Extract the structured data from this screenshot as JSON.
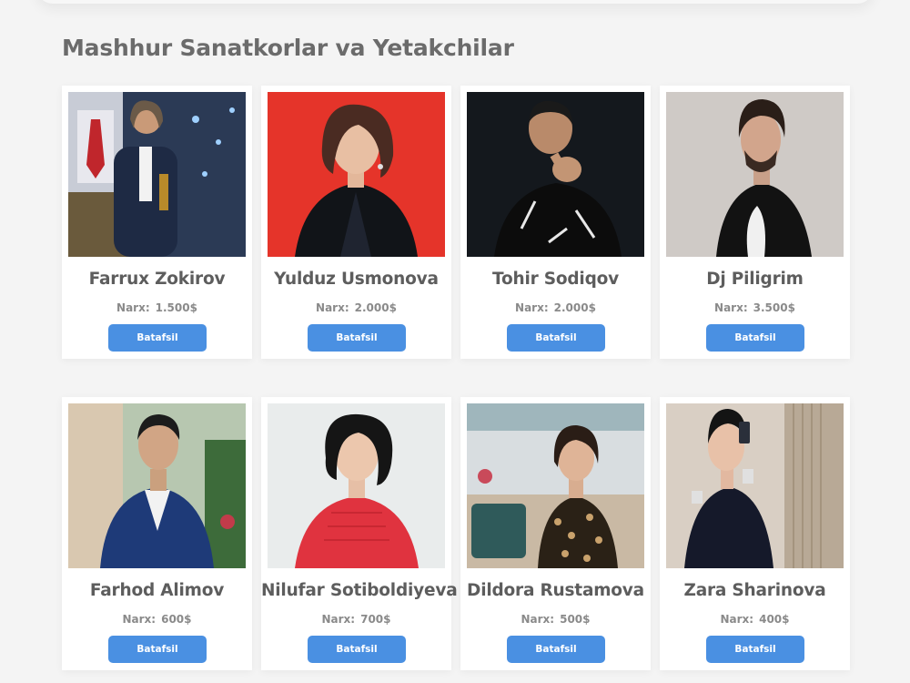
{
  "section": {
    "title": "Mashhur Sanatkorlar va Yetakchilar"
  },
  "price_label": "Narx:",
  "details_label": "Batafsil",
  "artists": [
    {
      "name": "Farrux Zokirov",
      "price": "1.500$"
    },
    {
      "name": "Yulduz Usmonova",
      "price": "2.000$"
    },
    {
      "name": "Tohir Sodiqov",
      "price": "2.000$"
    },
    {
      "name": "Dj Piligrim",
      "price": "3.500$"
    },
    {
      "name": "Farhod Alimov",
      "price": "600$"
    },
    {
      "name": "Nilufar Sotiboldiyeva",
      "price": "700$"
    },
    {
      "name": "Dildora Rustamova",
      "price": "500$"
    },
    {
      "name": "Zara Sharinova",
      "price": "400$"
    }
  ],
  "colors": {
    "button": "#4a90e2",
    "title_text": "#6b6b6b",
    "name_text": "#5d5d5d",
    "page_background": "#f4f4f4"
  }
}
